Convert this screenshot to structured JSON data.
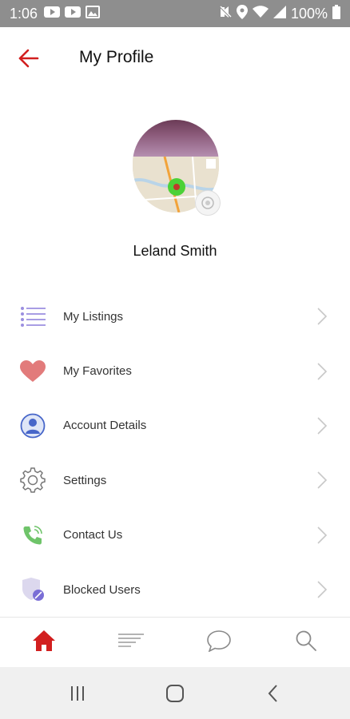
{
  "status_bar": {
    "time": "1:06",
    "battery": "100%"
  },
  "header": {
    "title": "My Profile"
  },
  "profile": {
    "name": "Leland Smith"
  },
  "menu": {
    "items": [
      {
        "label": "My Listings",
        "icon": "list-icon"
      },
      {
        "label": "My Favorites",
        "icon": "heart-icon"
      },
      {
        "label": "Account Details",
        "icon": "user-icon"
      },
      {
        "label": "Settings",
        "icon": "gear-icon"
      },
      {
        "label": "Contact Us",
        "icon": "phone-icon"
      },
      {
        "label": "Blocked Users",
        "icon": "shield-block-icon"
      }
    ]
  },
  "tabs": [
    "home-icon",
    "feed-icon",
    "chat-icon",
    "search-icon"
  ],
  "colors": {
    "accent": "#d21f1f",
    "status_bar": "#8e8e8e",
    "nav_bar": "#f0f0f0"
  }
}
